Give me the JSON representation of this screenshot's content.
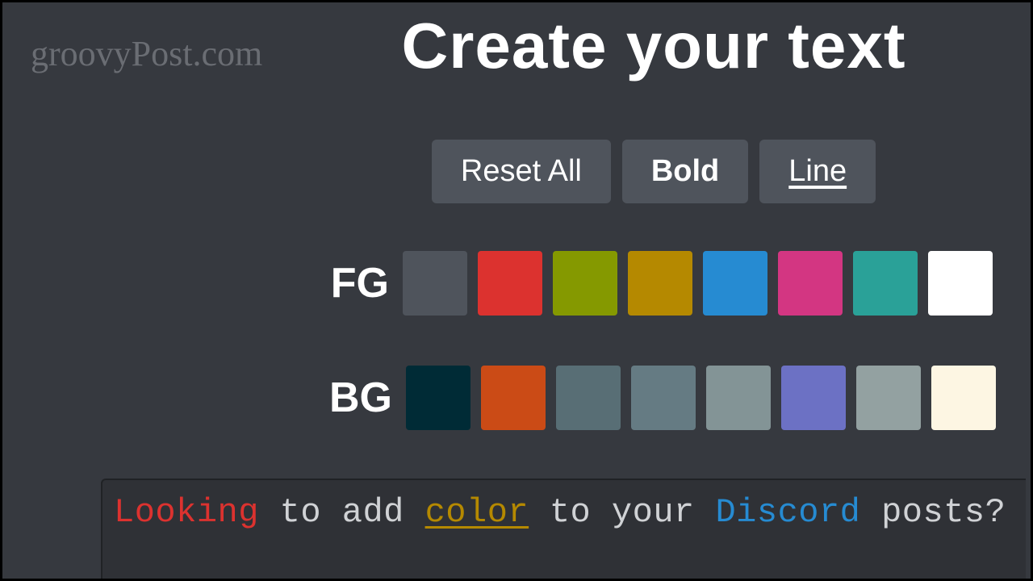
{
  "watermark": "groovyPost.com",
  "title": "Create your text",
  "toolbar": {
    "reset": "Reset All",
    "bold": "Bold",
    "line": "Line"
  },
  "fg": {
    "label": "FG",
    "swatches": [
      "#4f545c",
      "#dc322f",
      "#859900",
      "#b58900",
      "#268bd2",
      "#d33682",
      "#2aa198",
      "#ffffff"
    ]
  },
  "bg": {
    "label": "BG",
    "swatches": [
      "#002b36",
      "#cb4b16",
      "#586e75",
      "#657b83",
      "#839496",
      "#6c71c4",
      "#93a1a1",
      "#fdf6e3"
    ]
  },
  "editor": {
    "spans": [
      {
        "text": "Looking",
        "cls": "ed-red"
      },
      {
        "text": " to add ",
        "cls": "ed-white"
      },
      {
        "text": "color",
        "cls": "ed-yellow"
      },
      {
        "text": " to your ",
        "cls": "ed-white"
      },
      {
        "text": "Discord",
        "cls": "ed-blue"
      },
      {
        "text": " posts?",
        "cls": "ed-white"
      }
    ]
  }
}
